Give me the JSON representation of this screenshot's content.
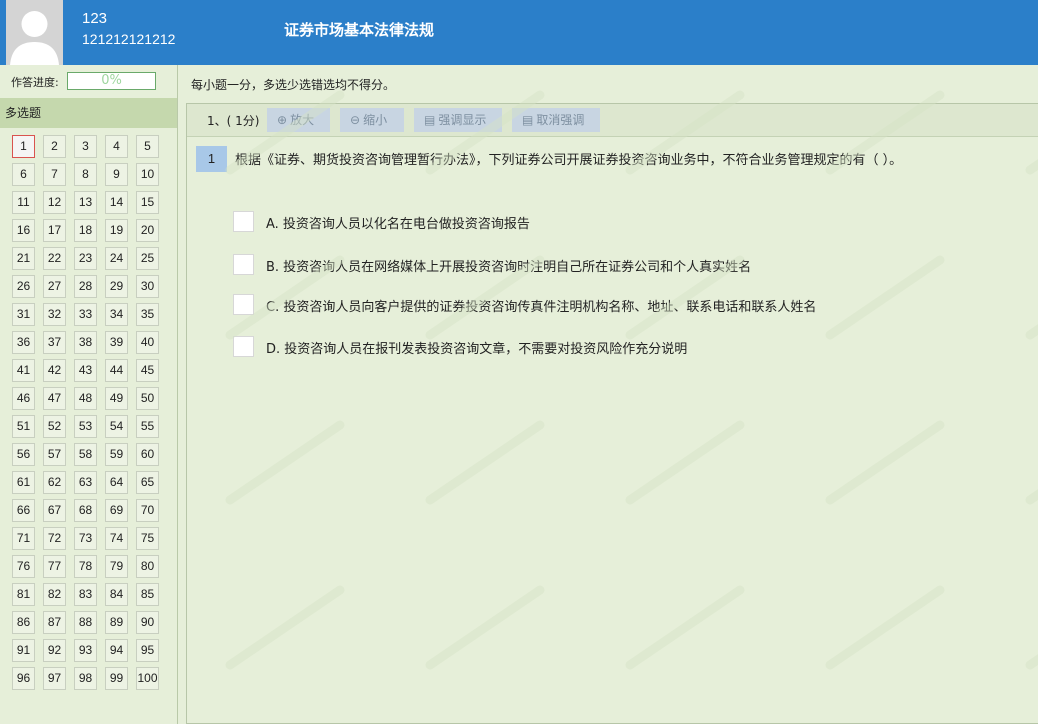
{
  "user": {
    "name": "123",
    "id": "121212121212"
  },
  "exam": {
    "title": "证券市场基本法律法规"
  },
  "sidebar": {
    "progress_label": "作答进度:",
    "progress_value": "0%",
    "section_title": "多选题",
    "current_question": 1,
    "questions": [
      "1",
      "2",
      "3",
      "4",
      "5",
      "6",
      "7",
      "8",
      "9",
      "10",
      "11",
      "12",
      "13",
      "14",
      "15",
      "16",
      "17",
      "18",
      "19",
      "20",
      "21",
      "22",
      "23",
      "24",
      "25",
      "26",
      "27",
      "28",
      "29",
      "30",
      "31",
      "32",
      "33",
      "34",
      "35",
      "36",
      "37",
      "38",
      "39",
      "40",
      "41",
      "42",
      "43",
      "44",
      "45",
      "46",
      "47",
      "48",
      "49",
      "50",
      "51",
      "52",
      "53",
      "54",
      "55",
      "56",
      "57",
      "58",
      "59",
      "60",
      "61",
      "62",
      "63",
      "64",
      "65",
      "66",
      "67",
      "68",
      "69",
      "70",
      "71",
      "72",
      "73",
      "74",
      "75",
      "76",
      "77",
      "78",
      "79",
      "80",
      "81",
      "82",
      "83",
      "84",
      "85",
      "86",
      "87",
      "88",
      "89",
      "90",
      "91",
      "92",
      "93",
      "94",
      "95",
      "96",
      "97",
      "98",
      "99",
      "100"
    ]
  },
  "main": {
    "instruction": "每小题一分，多选少选错选均不得分。",
    "toolbar": {
      "question_index": "1、( 1分)",
      "enlarge": "放大",
      "shrink": "缩小",
      "highlight": "强调显示",
      "cancel_highlight": "取消强调"
    },
    "question": {
      "number": "1",
      "stem": "根据《证券、期货投资咨询管理暂行办法》，下列证券公司开展证券投资咨询业务中，不符合业务管理规定的有（ ）。",
      "options": [
        {
          "label": "A. 投资咨询人员以化名在电台做投资咨询报告",
          "checked": false
        },
        {
          "label": "B. 投资咨询人员在网络媒体上开展投资咨询时注明自己所在证券公司和个人真实姓名",
          "checked": false
        },
        {
          "label": "C. 投资咨询人员向客户提供的证券投资咨询传真件注明机构名称、地址、联系电话和联系人姓名",
          "checked": false
        },
        {
          "label": "D. 投资咨询人员在报刊发表投资咨询文章，不需要对投资风险作充分说明",
          "checked": false
        }
      ]
    }
  },
  "colors": {
    "header": "#2b7fc9",
    "background": "#e6efd9",
    "current_question_border": "#d9534f"
  },
  "icons": {
    "avatar": "user-silhouette-icon",
    "enlarge": "zoom-in-icon",
    "shrink": "zoom-out-icon",
    "highlight": "document-icon",
    "cancel_highlight": "document-icon"
  }
}
